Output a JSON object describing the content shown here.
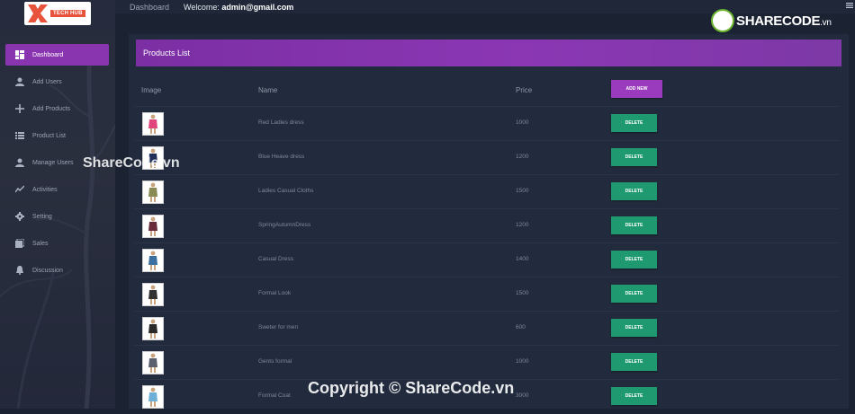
{
  "sidebar": {
    "logo": {
      "name": "TECH HUB",
      "sub": ""
    },
    "items": [
      {
        "label": "Dashboard",
        "icon": "dashboard-icon",
        "active": true
      },
      {
        "label": "Add Users",
        "icon": "user-icon"
      },
      {
        "label": "Add Products",
        "icon": "plus-icon"
      },
      {
        "label": "Product List",
        "icon": "list-icon"
      },
      {
        "label": "Manage Users",
        "icon": "user-icon"
      },
      {
        "label": "Activities",
        "icon": "activity-icon"
      },
      {
        "label": "Setting",
        "icon": "gear-icon"
      },
      {
        "label": "Sales",
        "icon": "sales-icon"
      },
      {
        "label": "Discussion",
        "icon": "bell-icon"
      }
    ]
  },
  "topbar": {
    "breadcrumb": "Dashboard",
    "welcome_prefix": "Welcome:",
    "welcome_user": "admin@gmail.com"
  },
  "card": {
    "title": "Products List",
    "columns": {
      "image": "Image",
      "name": "Name",
      "price": "Price"
    },
    "add_button": "ADD NEW",
    "delete_label": "DELETE",
    "rows": [
      {
        "name": "Red Ladies dress",
        "price": "1000",
        "color": "#e0457b"
      },
      {
        "name": "Blue Heave dress",
        "price": "1200",
        "color": "#1f2f5a"
      },
      {
        "name": "Ladies Casual Cloths",
        "price": "1500",
        "color": "#8a8a55"
      },
      {
        "name": "SpringAutumnDress",
        "price": "1200",
        "color": "#6a2a3a"
      },
      {
        "name": "Casual Dress",
        "price": "1400",
        "color": "#3b6fa0"
      },
      {
        "name": "Formal Look",
        "price": "1500",
        "color": "#333333"
      },
      {
        "name": "Sweter for men",
        "price": "600",
        "color": "#2a2a2a"
      },
      {
        "name": "Gents formal",
        "price": "1000",
        "color": "#5a6070"
      },
      {
        "name": "Formal Coat",
        "price": "3000",
        "color": "#6fb0d8"
      }
    ]
  },
  "watermarks": {
    "logo_main": "SHARECODE",
    "logo_suffix": ".vn",
    "middle": "ShareCode.vn",
    "bottom": "Copyright © ShareCode.vn"
  }
}
